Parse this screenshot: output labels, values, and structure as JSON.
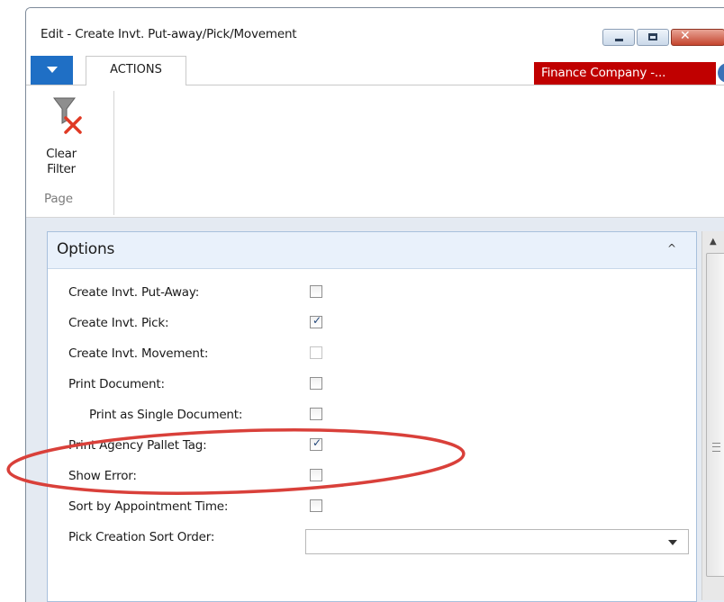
{
  "window": {
    "title": "Edit - Create Invt. Put-away/Pick/Movement",
    "controls": {
      "minimize": "minimize-icon",
      "maximize": "maximize-icon",
      "close_glyph": "✕"
    }
  },
  "ribbon": {
    "tab_label": "ACTIONS",
    "company": "Finance Company -...",
    "help_glyph": "?",
    "clear_filter_label": "Clear Filter",
    "group_label": "Page"
  },
  "options": {
    "title": "Options",
    "collapse_glyph": "^",
    "fields": [
      {
        "label": "Create Invt. Put-Away:",
        "checked": false,
        "enabled": true
      },
      {
        "label": "Create Invt. Pick:",
        "checked": true,
        "enabled": true
      },
      {
        "label": "Create Invt. Movement:",
        "checked": false,
        "enabled": false
      },
      {
        "label": "Print Document:",
        "checked": false,
        "enabled": true
      },
      {
        "label": "Print as Single Document:",
        "checked": false,
        "enabled": true
      },
      {
        "label": "Print Agency Pallet Tag:",
        "checked": true,
        "enabled": true
      },
      {
        "label": "Show Error:",
        "checked": false,
        "enabled": true
      },
      {
        "label": "Sort by Appointment Time:",
        "checked": false,
        "enabled": true
      },
      {
        "label": "Pick Creation Sort Order:",
        "value": ""
      }
    ]
  },
  "colors": {
    "app_menu": "#1f6fc5",
    "company_badge": "#c00000",
    "highlight_ellipse": "#d9403a",
    "fasttab_border": "#a8c0dc"
  },
  "icons": {
    "filter": "clear-filter-icon",
    "check": "✓"
  }
}
